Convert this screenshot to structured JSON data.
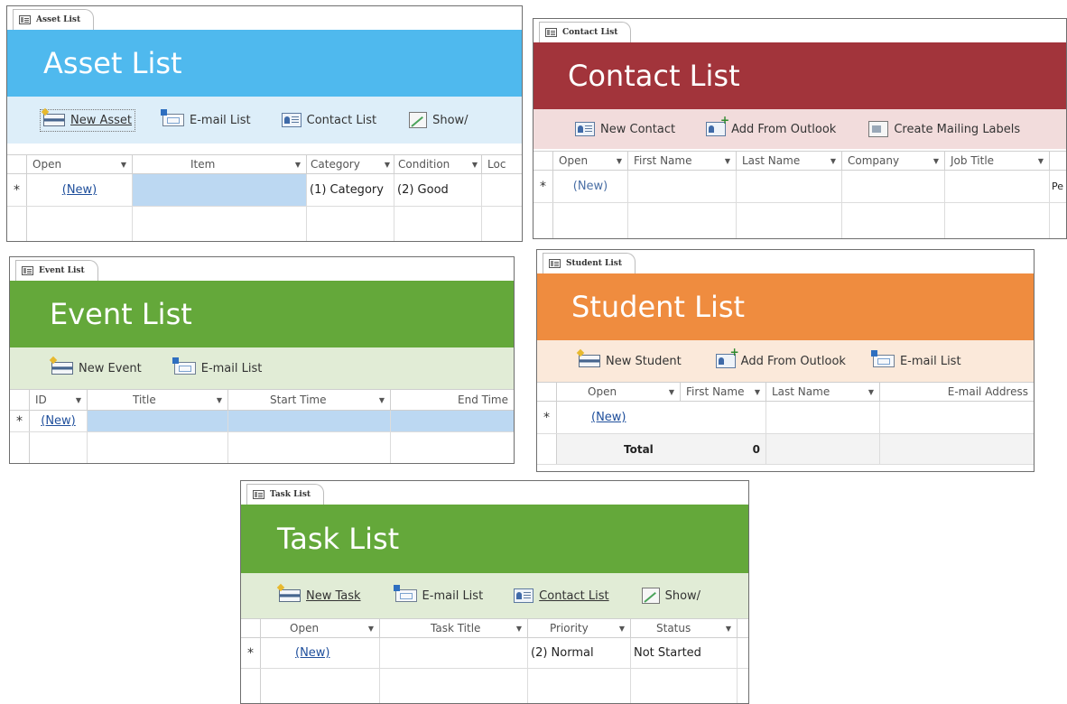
{
  "asset": {
    "tab_label": "Asset List",
    "title": "Asset List",
    "toolbar": {
      "new": "New Asset",
      "email": "E-mail List",
      "contact": "Contact List",
      "show": "Show/"
    },
    "columns": [
      "Open",
      "Item",
      "Category",
      "Condition",
      "Loc"
    ],
    "new_row": {
      "marker": "*",
      "open": "(New)",
      "item": "",
      "category": "(1) Category",
      "condition": "(2) Good"
    }
  },
  "contact": {
    "tab_label": "Contact List",
    "title": "Contact List",
    "toolbar": {
      "new": "New Contact",
      "outlook": "Add From Outlook",
      "labels": "Create Mailing Labels"
    },
    "columns": [
      "Open",
      "First Name",
      "Last Name",
      "Company",
      "Job Title",
      ""
    ],
    "new_row": {
      "marker": "*",
      "open": "(New)",
      "cutoff": "Pe"
    }
  },
  "event": {
    "tab_label": "Event List",
    "title": "Event List",
    "toolbar": {
      "new": "New Event",
      "email": "E-mail List"
    },
    "columns": [
      "ID",
      "Title",
      "Start Time",
      "End Time"
    ],
    "new_row": {
      "marker": "*",
      "open": "(New)"
    }
  },
  "student": {
    "tab_label": "Student List",
    "title": "Student List",
    "toolbar": {
      "new": "New Student",
      "outlook": "Add From Outlook",
      "email": "E-mail List"
    },
    "columns": [
      "Open",
      "First Name",
      "Last Name",
      "E-mail Address"
    ],
    "new_row": {
      "marker": "*",
      "open": "(New)"
    },
    "total_row": {
      "label": "Total",
      "value": "0"
    }
  },
  "task": {
    "tab_label": "Task List",
    "title": "Task List",
    "toolbar": {
      "new": "New Task",
      "email": "E-mail List",
      "contact": "Contact List",
      "show": "Show/"
    },
    "columns": [
      "Open",
      "Task Title",
      "Priority",
      "Status"
    ],
    "new_row": {
      "marker": "*",
      "open": "(New)",
      "priority": "(2) Normal",
      "status": "Not Started"
    }
  },
  "colors": {
    "asset_banner": "#4fb9ee",
    "asset_toolbar": "#ddeef9",
    "contact_banner": "#a2343b",
    "contact_toolbar": "#f2dcdc",
    "event_banner": "#64a83a",
    "event_toolbar": "#e1ecd6",
    "student_banner": "#ef8c3f",
    "student_toolbar": "#fbe9da",
    "task_banner": "#64a83a",
    "task_toolbar": "#e1ecd6",
    "new_row_highlight": "#bcd8f2"
  }
}
